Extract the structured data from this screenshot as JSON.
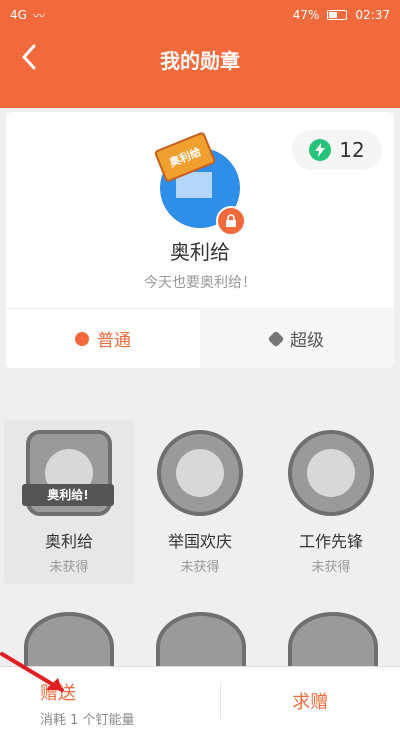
{
  "statusbar": {
    "signal": "4G",
    "battery": "47%",
    "time": "02:37"
  },
  "header": {
    "title": "我的勋章"
  },
  "profile": {
    "ribbon_text": "奥利给",
    "energy_count": "12",
    "username": "奥利给",
    "motto": "今天也要奥利给！"
  },
  "tabs": [
    {
      "label": "普通"
    },
    {
      "label": "超级"
    }
  ],
  "medals": [
    {
      "name": "奥利给",
      "status": "未获得",
      "banner": "奥利给!"
    },
    {
      "name": "举国欢庆",
      "status": "未获得"
    },
    {
      "name": "工作先锋",
      "status": "未获得"
    }
  ],
  "bottom": {
    "gift_label": "赠送",
    "gift_sub": "消耗 1 个钉能量",
    "request_label": "求赠"
  },
  "colors": {
    "accent": "#f26a3b",
    "energy": "#27c37b"
  },
  "icons": [
    "back-icon",
    "lock-icon",
    "bolt-icon",
    "star-icon",
    "diamond-icon"
  ]
}
